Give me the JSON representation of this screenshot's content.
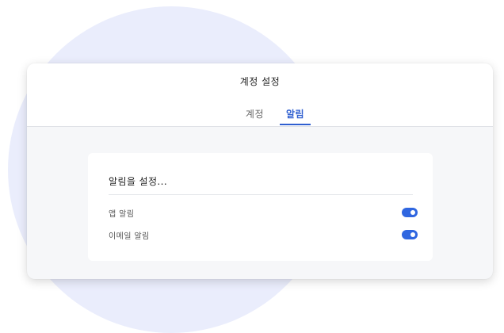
{
  "window": {
    "title": "계정 설정"
  },
  "tabs": [
    {
      "label": "계정",
      "active": false
    },
    {
      "label": "알림",
      "active": true
    }
  ],
  "notifications": {
    "heading": "알림을 설정...",
    "items": [
      {
        "label": "앱 알림",
        "enabled": true
      },
      {
        "label": "이메일 알림",
        "enabled": true
      }
    ]
  },
  "colors": {
    "accent": "#2f66e0",
    "background_circle": "#eaedfc",
    "window_body": "#f6f7f9"
  }
}
